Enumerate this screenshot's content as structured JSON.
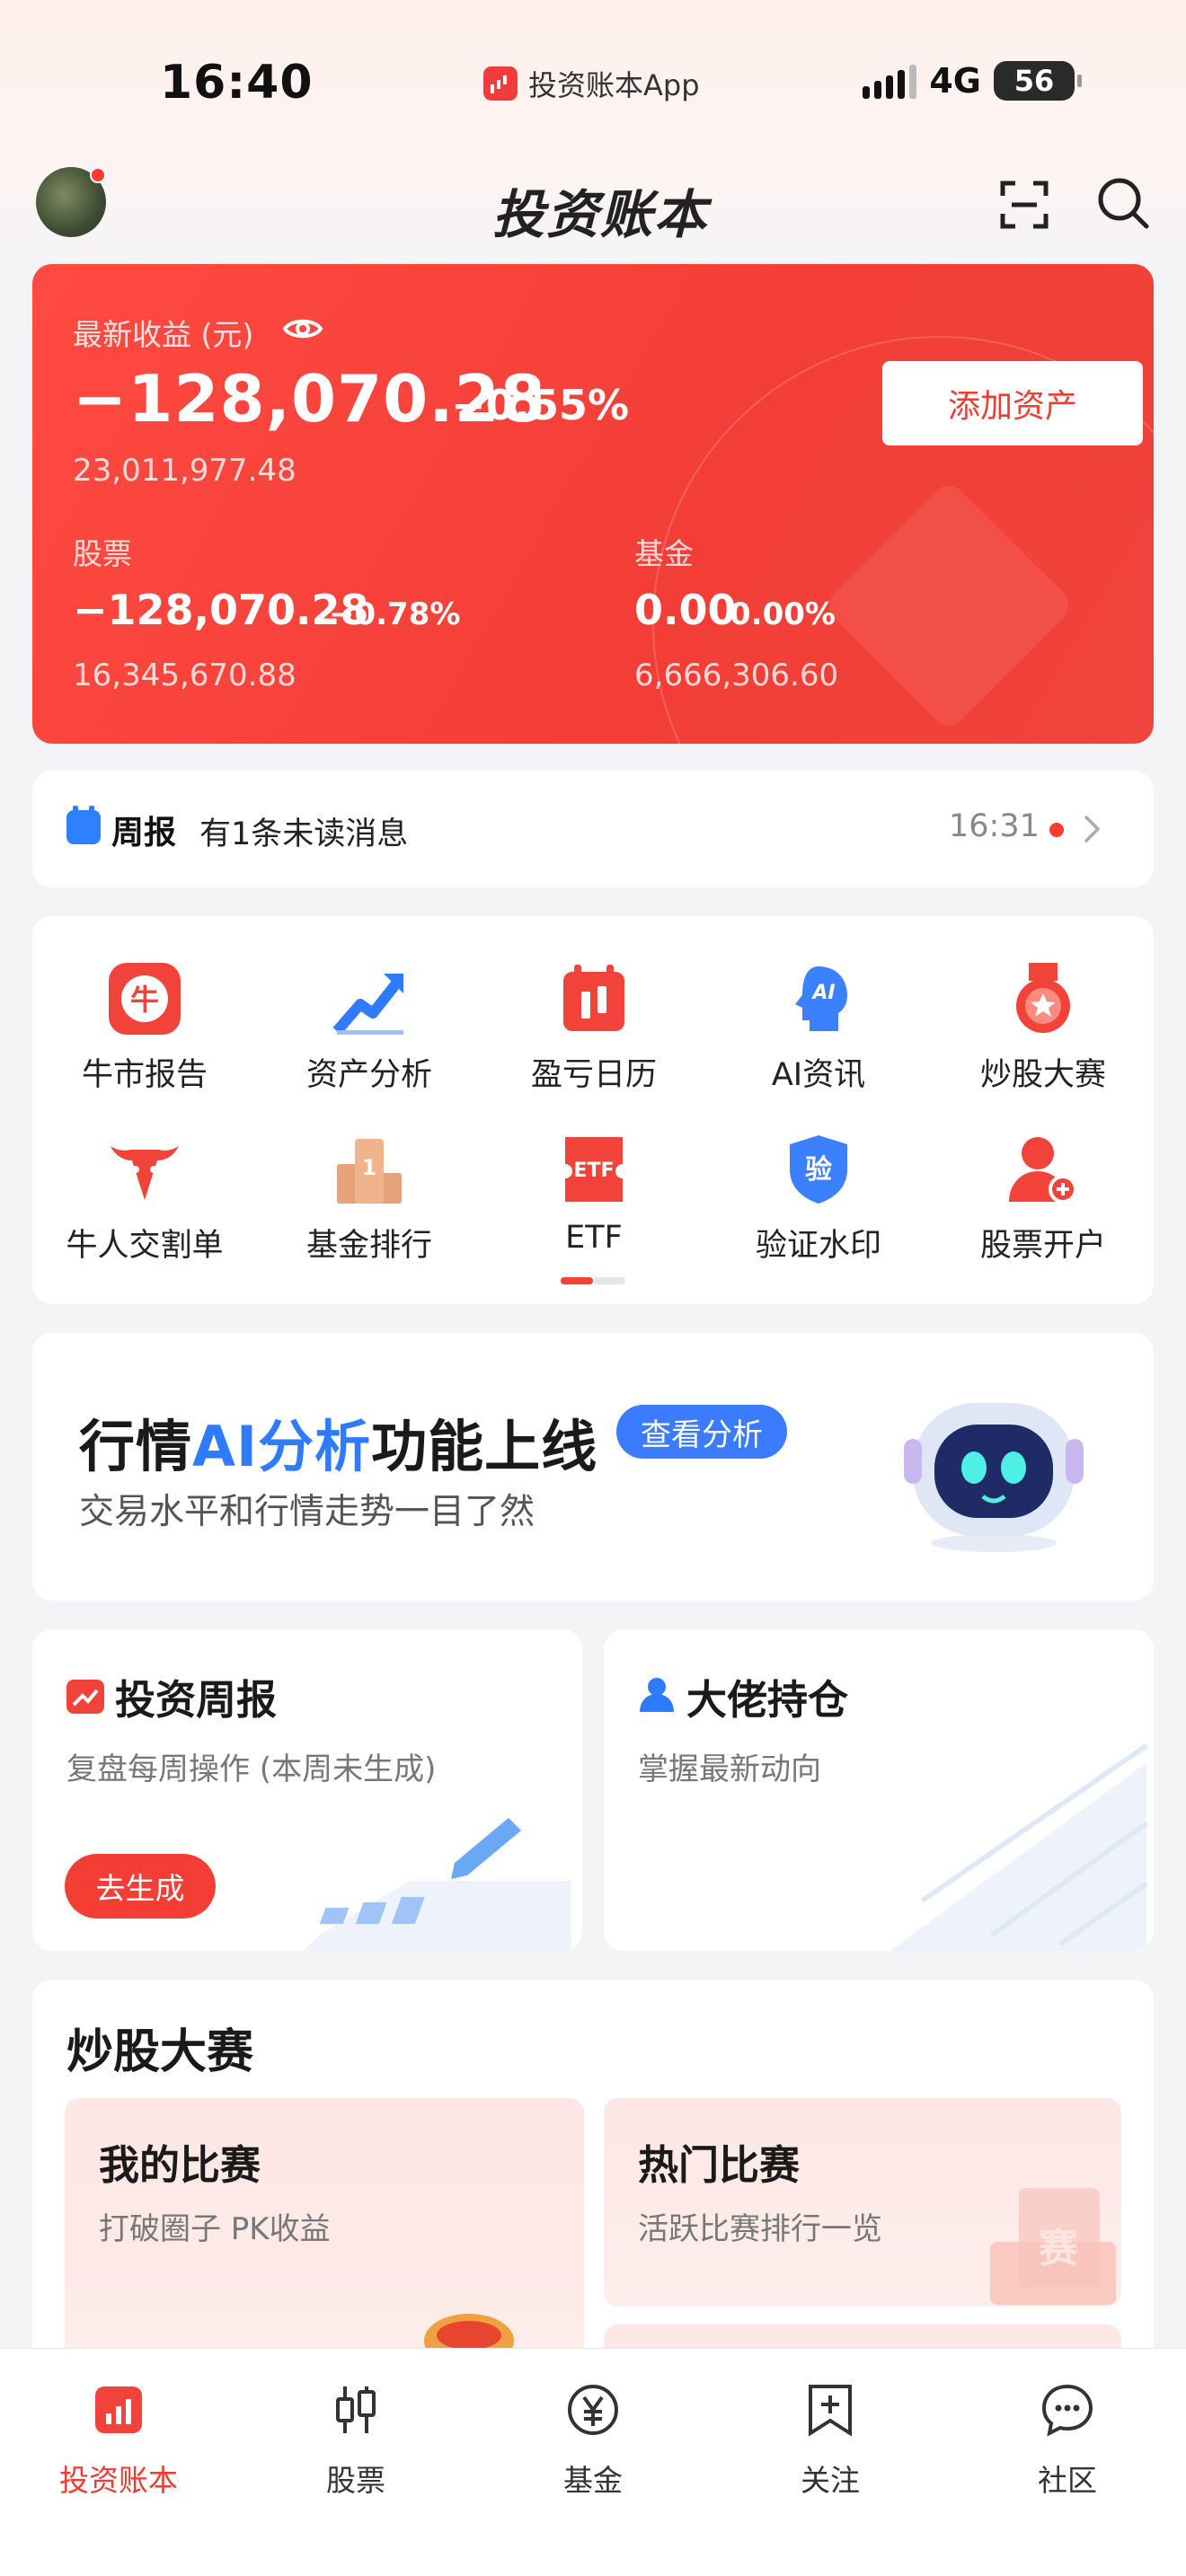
{
  "status_bar": {
    "time": "16:40",
    "app_name": "投资账本App",
    "network": "4G",
    "battery": "56"
  },
  "header": {
    "brand": "投资账本",
    "icons": [
      "scan-icon",
      "search-icon"
    ]
  },
  "summary": {
    "label": "最新收益 (元)",
    "total_profit": "−128,070.28",
    "total_pct": "−0.55%",
    "total_assets": "23,011,977.48",
    "add_button": "添加资产",
    "stocks": {
      "label": "股票",
      "profit": "−128,070.28",
      "pct": "−0.78%",
      "assets": "16,345,670.88"
    },
    "funds": {
      "label": "基金",
      "profit": "0.00",
      "pct": "0.00%",
      "assets": "6,666,306.60"
    }
  },
  "notice": {
    "title": "周报",
    "message": "有1条未读消息",
    "time": "16:31"
  },
  "grid": {
    "items": [
      {
        "label": "牛市报告",
        "icon": "bull-report-icon"
      },
      {
        "label": "资产分析",
        "icon": "asset-analysis-icon"
      },
      {
        "label": "盈亏日历",
        "icon": "pnl-calendar-icon"
      },
      {
        "label": "AI资讯",
        "icon": "ai-news-icon"
      },
      {
        "label": "炒股大赛",
        "icon": "contest-medal-icon"
      },
      {
        "label": "牛人交割单",
        "icon": "bull-head-icon"
      },
      {
        "label": "基金排行",
        "icon": "fund-rank-icon"
      },
      {
        "label": "ETF",
        "icon": "etf-icon"
      },
      {
        "label": "验证水印",
        "icon": "verify-shield-icon"
      },
      {
        "label": "股票开户",
        "icon": "account-open-icon"
      }
    ],
    "colors": {
      "accent": "#f2433a",
      "blue": "#2f7bff"
    }
  },
  "ai_banner": {
    "title_pre": "行情",
    "title_ai": "AI分析",
    "title_post": "功能上线",
    "pill": "查看分析",
    "subtitle": "交易水平和行情走势一目了然"
  },
  "cards": {
    "weekly": {
      "title": "投资周报",
      "subtitle": "复盘每周操作 (本周未生成)",
      "button": "去生成"
    },
    "big": {
      "title": "大佬持仓",
      "subtitle": "掌握最新动向"
    }
  },
  "contest": {
    "title": "炒股大赛",
    "mine": {
      "title": "我的比赛",
      "subtitle": "打破圈子 PK收益"
    },
    "hot": {
      "title": "热门比赛",
      "subtitle": "活跃比赛排行一览"
    }
  },
  "tabs": [
    {
      "label": "投资账本",
      "active": true
    },
    {
      "label": "股票"
    },
    {
      "label": "基金"
    },
    {
      "label": "关注"
    },
    {
      "label": "社区"
    }
  ]
}
